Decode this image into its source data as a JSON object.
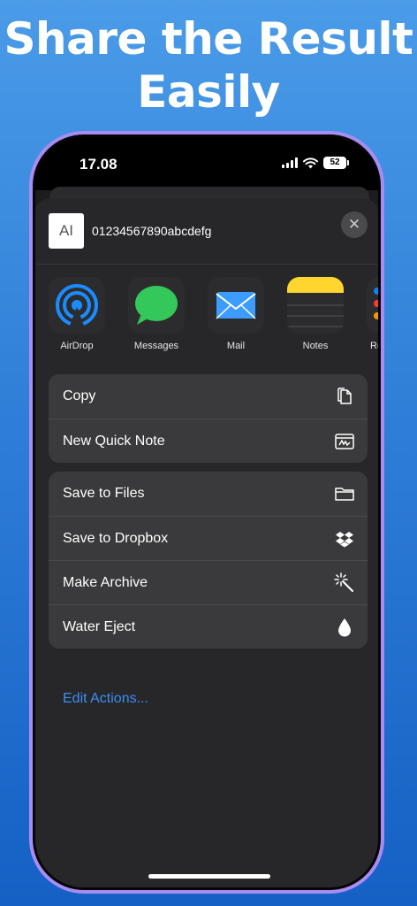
{
  "headline": {
    "line1": "Share the Result",
    "line2": "Easily"
  },
  "status_bar": {
    "time": "17.08",
    "battery": "52"
  },
  "share_sheet": {
    "thumbnail_text": "AI",
    "title": "01234567890abcdefg",
    "close_glyph": "✕",
    "apps": [
      {
        "label": "AirDrop",
        "icon": "airdrop-icon"
      },
      {
        "label": "Messages",
        "icon": "messages-icon"
      },
      {
        "label": "Mail",
        "icon": "mail-icon"
      },
      {
        "label": "Notes",
        "icon": "notes-icon"
      },
      {
        "label": "Re",
        "icon": "reminders-icon"
      }
    ],
    "group1": [
      {
        "label": "Copy",
        "icon": "copy-icon"
      },
      {
        "label": "New Quick Note",
        "icon": "quick-note-icon"
      }
    ],
    "group2": [
      {
        "label": "Save to Files",
        "icon": "folder-icon"
      },
      {
        "label": "Save to Dropbox",
        "icon": "dropbox-icon"
      },
      {
        "label": "Make Archive",
        "icon": "magic-wand-icon"
      },
      {
        "label": "Water Eject",
        "icon": "water-drop-icon"
      }
    ],
    "edit_actions": "Edit Actions..."
  },
  "colors": {
    "background_top": "#4a9be8",
    "background_bottom": "#1560c4",
    "phone_frame": "#a88cf2",
    "link": "#3b8ef5"
  }
}
